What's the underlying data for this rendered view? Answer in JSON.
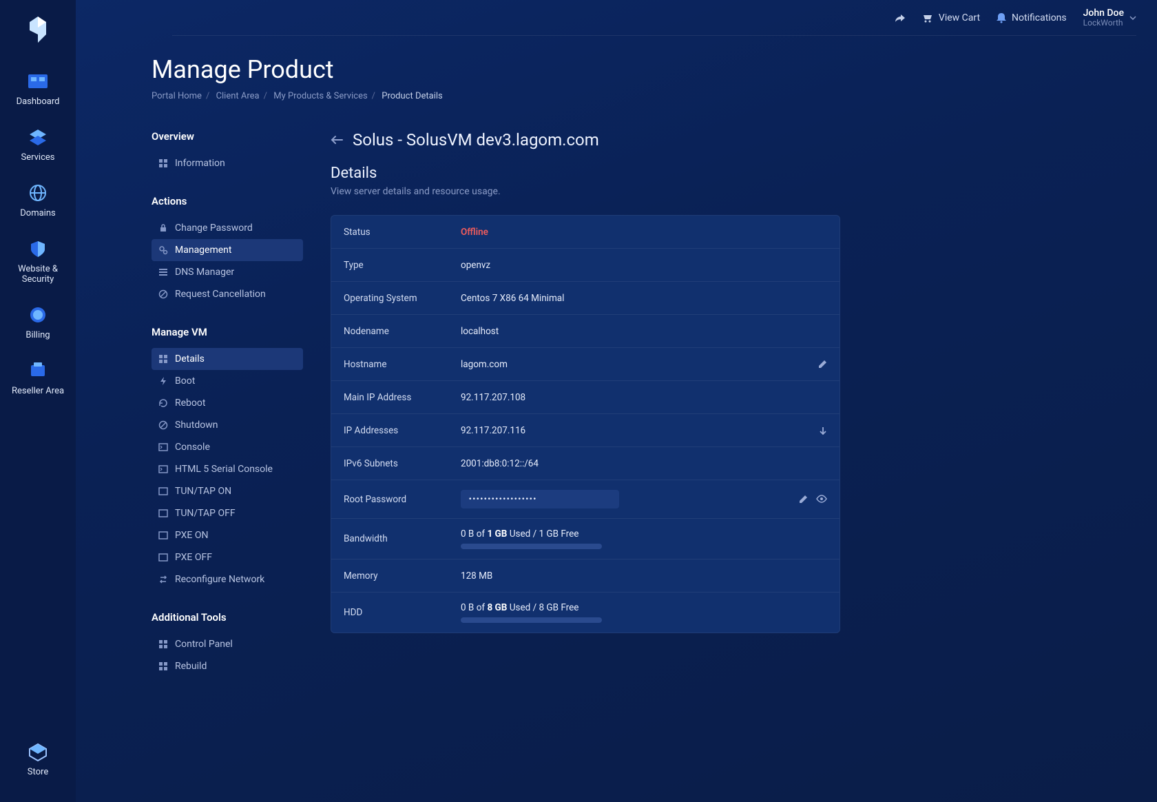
{
  "topbar": {
    "share_icon": "share",
    "cart_label": "View Cart",
    "notifications_label": "Notifications",
    "user_name": "John Doe",
    "user_company": "LockWorth"
  },
  "leftnav": {
    "items": [
      {
        "id": "dashboard",
        "label": "Dashboard"
      },
      {
        "id": "services",
        "label": "Services"
      },
      {
        "id": "domains",
        "label": "Domains"
      },
      {
        "id": "website-security",
        "label": "Website & Security"
      },
      {
        "id": "billing",
        "label": "Billing"
      },
      {
        "id": "reseller-area",
        "label": "Reseller Area"
      }
    ],
    "store_label": "Store"
  },
  "page": {
    "title": "Manage Product",
    "breadcrumbs": [
      "Portal Home",
      "Client Area",
      "My Products & Services",
      "Product Details"
    ]
  },
  "sidemenu": {
    "groups": [
      {
        "title": "Overview",
        "items": [
          {
            "id": "information",
            "label": "Information",
            "icon": "grid",
            "active": false
          }
        ]
      },
      {
        "title": "Actions",
        "items": [
          {
            "id": "change-password",
            "label": "Change Password",
            "icon": "lock",
            "active": false
          },
          {
            "id": "management",
            "label": "Management",
            "icon": "gears",
            "active": true
          },
          {
            "id": "dns-manager",
            "label": "DNS Manager",
            "icon": "list",
            "active": false
          },
          {
            "id": "request-cancellation",
            "label": "Request Cancellation",
            "icon": "ban",
            "active": false
          }
        ]
      },
      {
        "title": "Manage VM",
        "items": [
          {
            "id": "details",
            "label": "Details",
            "icon": "grid",
            "active": true
          },
          {
            "id": "boot",
            "label": "Boot",
            "icon": "bolt",
            "active": false
          },
          {
            "id": "reboot",
            "label": "Reboot",
            "icon": "refresh",
            "active": false
          },
          {
            "id": "shutdown",
            "label": "Shutdown",
            "icon": "ban",
            "active": false
          },
          {
            "id": "console",
            "label": "Console",
            "icon": "terminal",
            "active": false
          },
          {
            "id": "html5-serial-console",
            "label": "HTML 5 Serial Console",
            "icon": "terminal",
            "active": false
          },
          {
            "id": "tuntap-on",
            "label": "TUN/TAP ON",
            "icon": "terminal",
            "active": false
          },
          {
            "id": "tuntap-off",
            "label": "TUN/TAP OFF",
            "icon": "terminal",
            "active": false
          },
          {
            "id": "pxe-on",
            "label": "PXE ON",
            "icon": "terminal",
            "active": false
          },
          {
            "id": "pxe-off",
            "label": "PXE OFF",
            "icon": "terminal",
            "active": false
          },
          {
            "id": "reconfigure-network",
            "label": "Reconfigure Network",
            "icon": "swap",
            "active": false
          }
        ]
      },
      {
        "title": "Additional Tools",
        "items": [
          {
            "id": "control-panel",
            "label": "Control Panel",
            "icon": "grid",
            "active": false
          },
          {
            "id": "rebuild",
            "label": "Rebuild",
            "icon": "grid",
            "active": false
          }
        ]
      }
    ]
  },
  "content": {
    "product_title": "Solus - SolusVM dev3.lagom.com",
    "section_title": "Details",
    "section_sub": "View server details and resource usage.",
    "rows": {
      "status_label": "Status",
      "status_value": "Offline",
      "type_label": "Type",
      "type_value": "openvz",
      "os_label": "Operating System",
      "os_value": "Centos 7 X86 64 Minimal",
      "nodename_label": "Nodename",
      "nodename_value": "localhost",
      "hostname_label": "Hostname",
      "hostname_value": "lagom.com",
      "mainip_label": "Main IP Address",
      "mainip_value": "92.117.207.108",
      "ipaddr_label": "IP Addresses",
      "ipaddr_value": "92.117.207.116",
      "ipv6_label": "IPv6 Subnets",
      "ipv6_value": "2001:db8:0:12::/64",
      "rootpw_label": "Root Password",
      "rootpw_value": "••••••••••••••••••",
      "bandwidth_label": "Bandwidth",
      "bandwidth_used": "0 B",
      "bandwidth_total": "1 GB",
      "bandwidth_free": "1 GB Free",
      "memory_label": "Memory",
      "memory_value": "128 MB",
      "hdd_label": "HDD",
      "hdd_used": "0 B",
      "hdd_total": "8 GB",
      "hdd_free": "8 GB Free"
    }
  }
}
